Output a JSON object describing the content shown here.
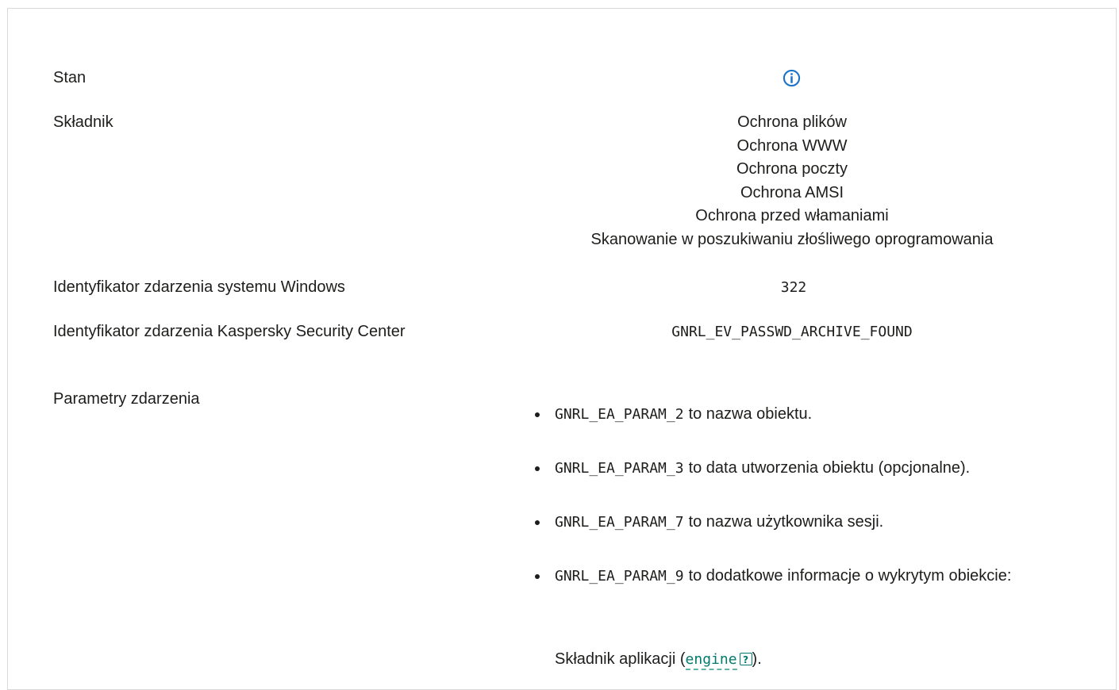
{
  "rows": {
    "state": {
      "label": "Stan",
      "icon": "info-icon"
    },
    "component": {
      "label": "Składnik",
      "values": [
        "Ochrona plików",
        "Ochrona WWW",
        "Ochrona poczty",
        "Ochrona AMSI",
        "Ochrona przed włamaniami",
        "Skanowanie w poszukiwaniu złośliwego oprogramowania"
      ]
    },
    "windows_event_id": {
      "label": "Identyfikator zdarzenia systemu Windows",
      "value": "322"
    },
    "ksc_event_id": {
      "label": "Identyfikator zdarzenia Kaspersky Security Center",
      "value": "GNRL_EV_PASSWD_ARCHIVE_FOUND"
    },
    "event_params": {
      "label": "Parametry zdarzenia",
      "items": [
        {
          "code": "GNRL_EA_PARAM_2",
          "text": "to nazwa obiektu."
        },
        {
          "code": "GNRL_EA_PARAM_3",
          "text": "to data utworzenia obiektu (opcjonalne)."
        },
        {
          "code": "GNRL_EA_PARAM_7",
          "text": "to nazwa użytkownika sesji."
        },
        {
          "code": "GNRL_EA_PARAM_9",
          "text": "to dodatkowe informacje o wykrytym obiekcie:"
        }
      ],
      "app_component_prefix": "Składnik aplikacji (",
      "app_component_link": "engine",
      "app_component_help": "?",
      "app_component_suffix": ")."
    }
  },
  "colors": {
    "accent": "#007a6e",
    "info": "#1a73c9",
    "text": "#1d1d1b"
  }
}
